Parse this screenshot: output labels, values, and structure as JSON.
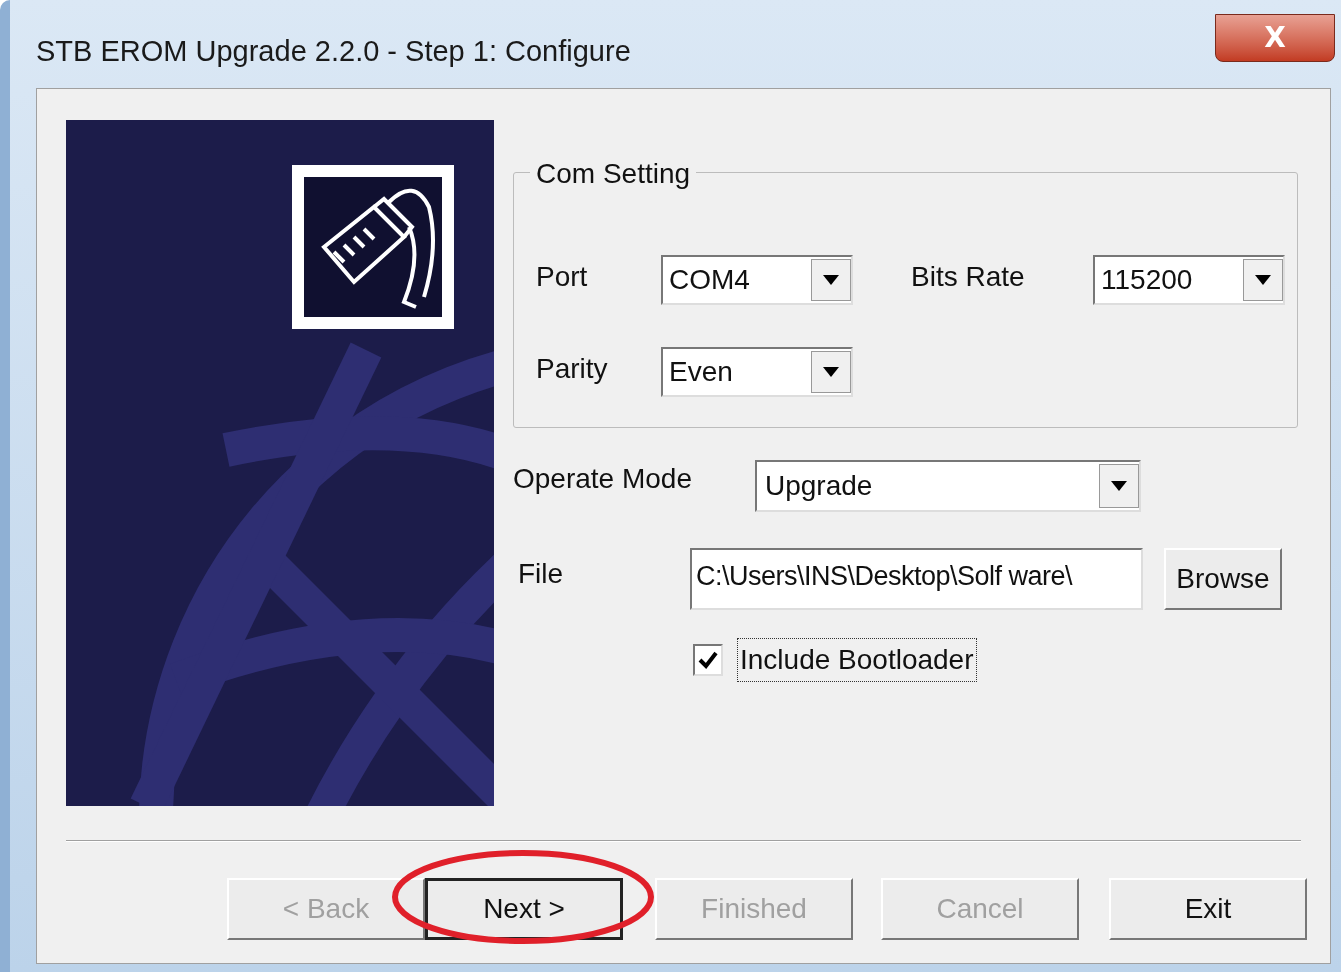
{
  "window": {
    "title": "STB EROM Upgrade 2.2.0  - Step 1: Configure",
    "close_label": "X"
  },
  "com_setting": {
    "title": "Com Setting",
    "fields": [
      {
        "label": "Port",
        "value": "COM4"
      },
      {
        "label": "Bits Rate",
        "value": "115200"
      },
      {
        "label": "Parity",
        "value": "Even"
      }
    ]
  },
  "operate_mode": {
    "label": "Operate Mode",
    "value": "Upgrade"
  },
  "file": {
    "label": "File",
    "value": "C:\\Users\\INS\\Desktop\\Solf ware\\",
    "browse": "Browse"
  },
  "include_bootloader": {
    "label": "Include Bootloader",
    "checked": true
  },
  "buttons": [
    {
      "label": "< Back",
      "disabled": true,
      "highlighted": false
    },
    {
      "label": "Next >",
      "disabled": false,
      "highlighted": true
    },
    {
      "label": "Finished",
      "disabled": true,
      "highlighted": false
    },
    {
      "label": "Cancel",
      "disabled": true,
      "highlighted": false
    },
    {
      "label": "Exit",
      "disabled": false,
      "highlighted": false
    }
  ]
}
